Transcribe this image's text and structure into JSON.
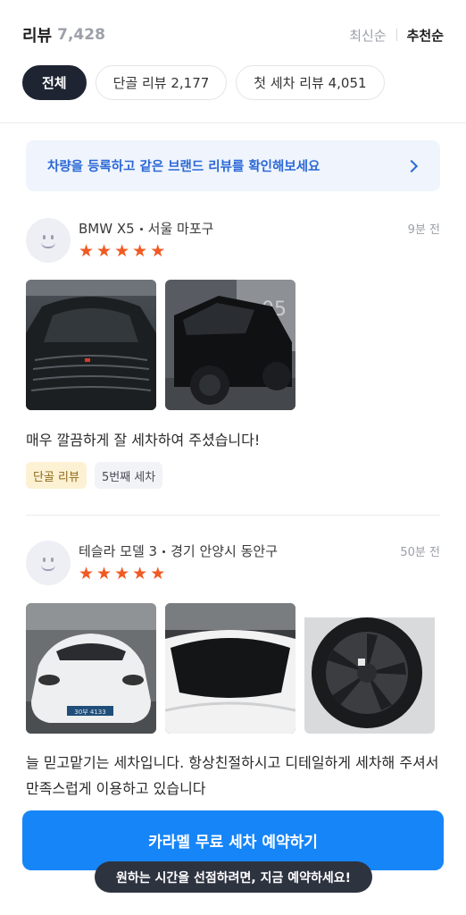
{
  "header": {
    "title": "리뷰",
    "count": "7,428",
    "sort": {
      "latest": "최신순",
      "recommended": "추천순",
      "active": "recommended"
    }
  },
  "filters": [
    {
      "label": "전체",
      "active": true
    },
    {
      "label": "단골 리뷰 2,177",
      "active": false
    },
    {
      "label": "첫 세차 리뷰 4,051",
      "active": false
    }
  ],
  "banner": {
    "text": "차량을 등록하고 같은 브랜드 리뷰를 확인해보세요",
    "icon": "chevron-right-icon"
  },
  "reviews": [
    {
      "car": "BMW X5",
      "location": "서울 마포구",
      "time": "9분 전",
      "rating": 5,
      "photo_count": 2,
      "text": "매우 깔끔하게 잘 세차하여 주셨습니다!",
      "tags": [
        "단골 리뷰",
        "5번째 세차"
      ]
    },
    {
      "car": "테슬라 모델 3",
      "location": "경기 안양시 동안구",
      "time": "50분 전",
      "rating": 5,
      "photo_count": 3,
      "text": "늘 믿고맡기는 세차입니다. 항상친절하시고 디테일하게 세차해 주셔서 만족스럽게 이용하고 있습니다",
      "plate": "30부 4133"
    }
  ],
  "cta": {
    "label": "카라멜 무료 세차 예약하기",
    "tooltip": "원하는 시간을 선점하려면, 지금 예약하세요!",
    "color": "#1685f8"
  },
  "colors": {
    "star": "#f05a23",
    "dark_chip": "#1f2433",
    "banner_text": "#2c68d6"
  }
}
